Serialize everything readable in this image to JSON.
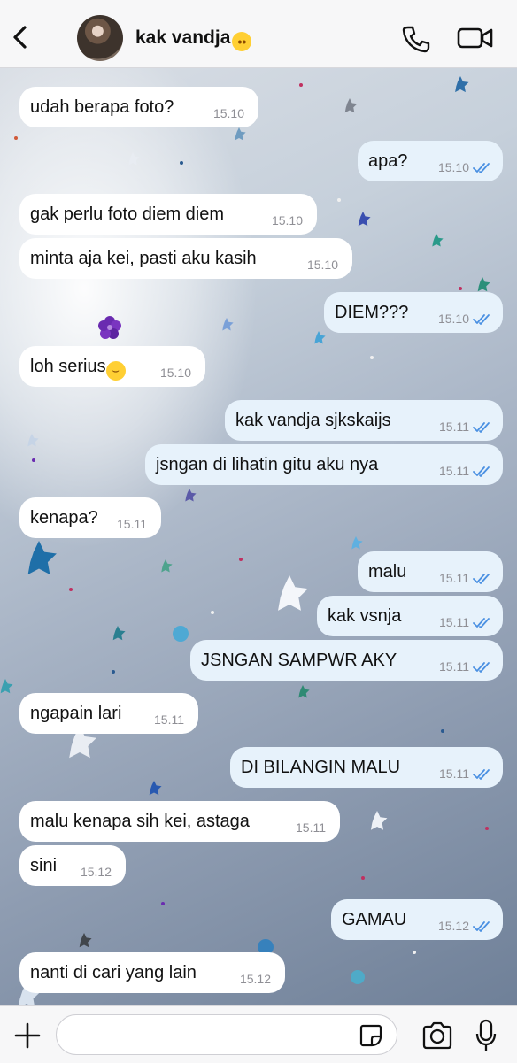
{
  "header": {
    "contact_name": "kak vandja",
    "contact_emoji": "😳",
    "back_icon": "chevron-left-icon",
    "call_icon": "phone-icon",
    "video_icon": "video-camera-icon"
  },
  "messages": [
    {
      "dir": "in",
      "text": "udah berapa foto?",
      "time": "15.10"
    },
    {
      "dir": "out",
      "text": "apa?",
      "time": "15.10"
    },
    {
      "dir": "in",
      "text": "gak perlu foto diem diem",
      "time": "15.10"
    },
    {
      "dir": "in",
      "text": "minta aja kei, pasti aku kasih",
      "time": "15.10"
    },
    {
      "dir": "out",
      "text": "DIEM???",
      "time": "15.10"
    },
    {
      "dir": "in",
      "text": "loh serius",
      "emoji": "😂",
      "time": "15.10"
    },
    {
      "dir": "out",
      "text": "kak vandja sjkskaijs",
      "time": "15.11"
    },
    {
      "dir": "out",
      "text": "jsngan di lihatin gitu aku nya",
      "time": "15.11"
    },
    {
      "dir": "in",
      "text": "kenapa?",
      "time": "15.11"
    },
    {
      "dir": "out",
      "text": "malu",
      "time": "15.11"
    },
    {
      "dir": "out",
      "text": "kak vsnja",
      "time": "15.11"
    },
    {
      "dir": "out",
      "text": "JSNGAN SAMPWR AKY",
      "time": "15.11"
    },
    {
      "dir": "in",
      "text": "ngapain lari",
      "time": "15.11"
    },
    {
      "dir": "out",
      "text": "DI BILANGIN MALU",
      "time": "15.11"
    },
    {
      "dir": "in",
      "text": "malu kenapa sih kei, astaga",
      "time": "15.11"
    },
    {
      "dir": "in",
      "text": "sini",
      "time": "15.12"
    },
    {
      "dir": "out",
      "text": "GAMAU",
      "time": "15.12"
    },
    {
      "dir": "in",
      "text": "nanti di cari yang lain",
      "time": "15.12"
    }
  ],
  "composer": {
    "input_value": "",
    "add_icon": "plus-icon",
    "sticker_icon": "sticker-icon",
    "camera_icon": "camera-icon",
    "mic_icon": "microphone-icon"
  },
  "colors": {
    "incoming_bubble": "#ffffff",
    "outgoing_bubble": "#e7f2fb",
    "read_ticks": "#4a90e2",
    "bar_background": "#f7f7f8"
  }
}
